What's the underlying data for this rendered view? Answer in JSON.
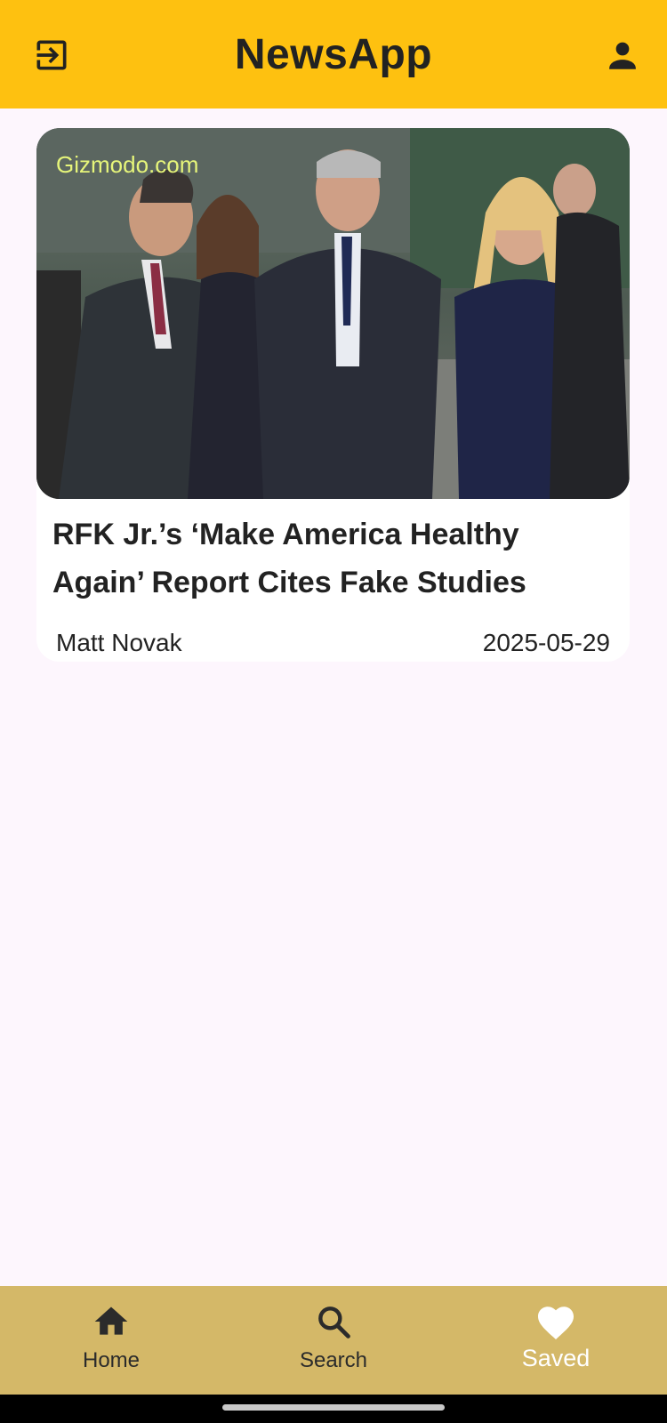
{
  "app": {
    "title": "NewsApp"
  },
  "top_bar": {
    "left_icon": "logout-icon",
    "right_icon": "account-icon"
  },
  "article": {
    "source": "Gizmodo.com",
    "title": "RFK Jr.’s ‘Make America Healthy Again’ Report Cites Fake Studies",
    "author": "Matt Novak",
    "date": "2025-05-29"
  },
  "bottom_nav": {
    "items": [
      {
        "label": "Home",
        "icon": "home-icon"
      },
      {
        "label": "Search",
        "icon": "search-icon"
      },
      {
        "label": "Saved",
        "icon": "heart-icon"
      }
    ]
  },
  "colors": {
    "top_bar": "#fec110",
    "bottom_nav": "#d4b868",
    "background": "#fdf6fd",
    "source_label": "#e6f57a"
  }
}
